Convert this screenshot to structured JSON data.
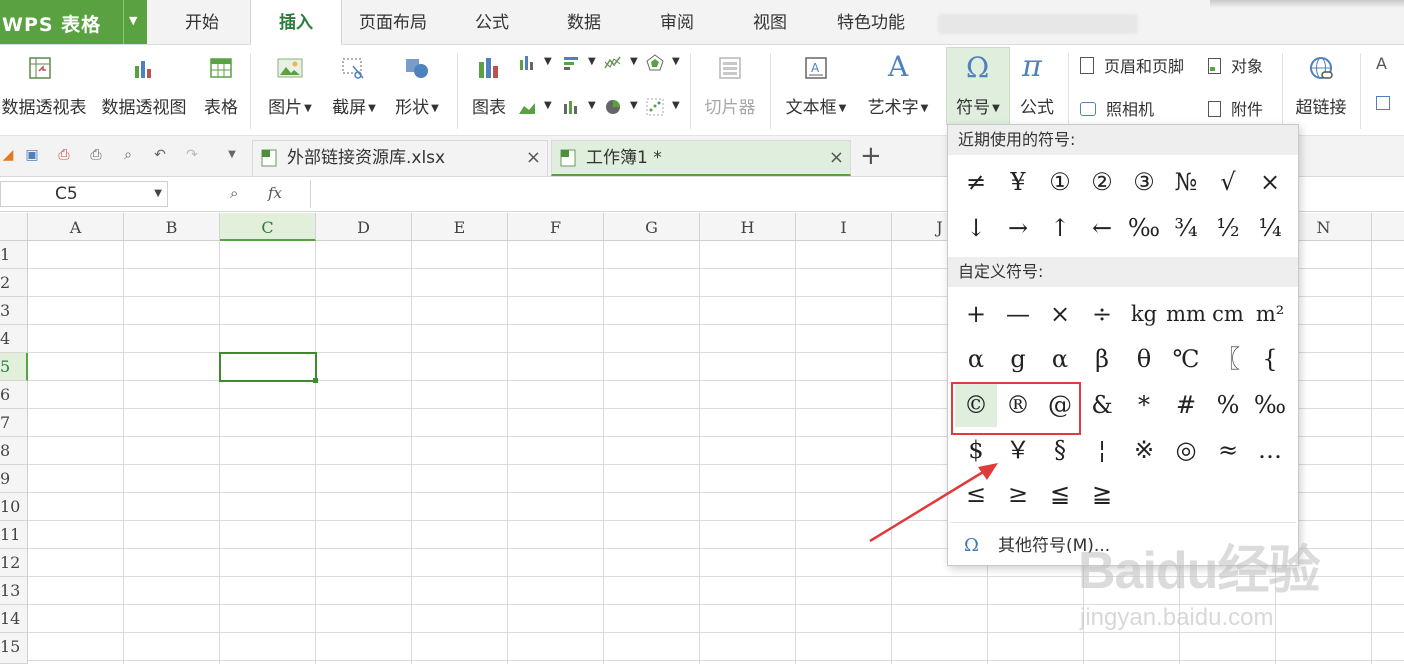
{
  "app": {
    "name": "WPS 表格"
  },
  "menu_tabs": [
    "开始",
    "插入",
    "页面布局",
    "公式",
    "数据",
    "审阅",
    "视图",
    "特色功能"
  ],
  "active_tab": "插入",
  "ribbon": {
    "pivot_table": "数据透视表",
    "pivot_chart": "数据透视图",
    "table": "表格",
    "picture": "图片",
    "screenshot": "截屏",
    "shapes": "形状",
    "chart": "图表",
    "slicer": "切片器",
    "textbox": "文本框",
    "wordart": "艺术字",
    "symbol": "符号",
    "equation": "公式",
    "header_footer": "页眉和页脚",
    "object": "对象",
    "camera": "照相机",
    "attachment": "附件",
    "hyperlink": "超链接",
    "symbol_glyph": "Ω",
    "equation_glyph": "π",
    "wordart_glyph": "A"
  },
  "file_tabs": [
    {
      "name": "外部链接资源库.xlsx",
      "active": false
    },
    {
      "name": "工作簿1 *",
      "active": true
    }
  ],
  "formula_bar": {
    "cell_ref": "C5",
    "fx": "fx",
    "value": ""
  },
  "columns": [
    "A",
    "B",
    "C",
    "D",
    "E",
    "F",
    "G",
    "H",
    "I",
    "J",
    "N"
  ],
  "rows": [
    "1",
    "2",
    "3",
    "4",
    "5",
    "6",
    "7",
    "8",
    "9",
    "10",
    "11",
    "12",
    "13",
    "14",
    "15"
  ],
  "selected_cell": "C5",
  "symbol_menu": {
    "recent_header": "近期使用的符号:",
    "recent": [
      [
        "≠",
        "¥",
        "①",
        "②",
        "③",
        "№",
        "√",
        "×"
      ],
      [
        "↓",
        "→",
        "↑",
        "←",
        "‰",
        "¾",
        "½",
        "¼"
      ]
    ],
    "custom_header": "自定义符号:",
    "custom": [
      [
        "+",
        "—",
        "×",
        "÷",
        "kg",
        "mm",
        "cm",
        "m²"
      ],
      [
        "α",
        "g",
        "α",
        "β",
        "θ",
        "℃",
        "〖",
        "{"
      ],
      [
        "©",
        "®",
        "@",
        "&",
        "*",
        "#",
        "%",
        "‰"
      ],
      [
        "$",
        "￥",
        "§",
        "¦",
        "※",
        "◎",
        "≈",
        "…"
      ],
      [
        "≤",
        "≥",
        "≦",
        "≧"
      ]
    ],
    "more": "其他符号(M)...",
    "more_icon": "Ω"
  },
  "watermark": {
    "line1": "Baidu经验",
    "line2": "jingyan.baidu.com"
  },
  "colors": {
    "accent": "#5aa141",
    "highlight_red": "#e03a3a"
  }
}
